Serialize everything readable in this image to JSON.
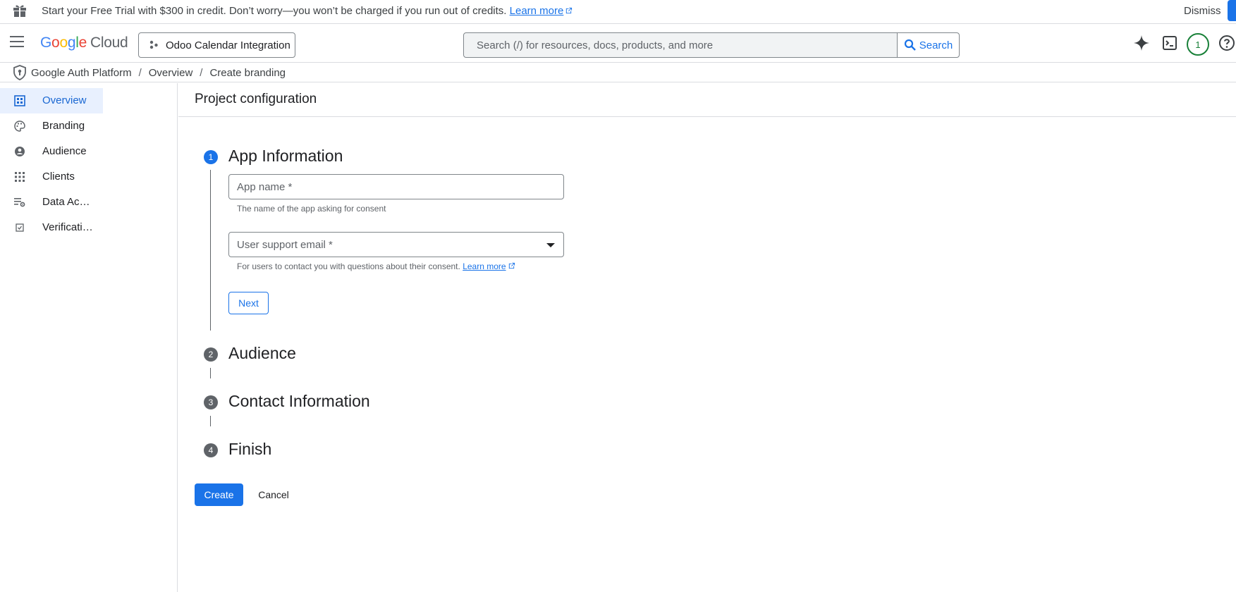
{
  "banner": {
    "message": "Start your Free Trial with $300 in credit. Don’t worry—you won’t be charged if you run out of credits.",
    "learn_more": "Learn more",
    "dismiss": "Dismiss"
  },
  "header": {
    "logo_google": [
      "G",
      "o",
      "o",
      "g",
      "l",
      "e"
    ],
    "logo_cloud": "Cloud",
    "project": "Odoo Calendar Integration",
    "search_placeholder": "Search (/) for resources, docs, products, and more",
    "search_button": "Search",
    "notification_count": "1"
  },
  "breadcrumb": {
    "items": [
      "Google Auth Platform",
      "Overview",
      "Create branding"
    ],
    "separator": "/"
  },
  "sidebar": {
    "items": [
      {
        "label": "Overview",
        "icon": "dashboard-icon",
        "active": true
      },
      {
        "label": "Branding",
        "icon": "palette-icon",
        "active": false
      },
      {
        "label": "Audience",
        "icon": "account-circle-icon",
        "active": false
      },
      {
        "label": "Clients",
        "icon": "apps-grid-icon",
        "active": false
      },
      {
        "label": "Data Access",
        "icon": "list-settings-icon",
        "active": false
      },
      {
        "label": "Verification Center",
        "icon": "check-box-icon",
        "active": false
      }
    ]
  },
  "main": {
    "title": "Project configuration",
    "steps": [
      {
        "number": "1",
        "title": "App Information",
        "active": true
      },
      {
        "number": "2",
        "title": "Audience",
        "active": false
      },
      {
        "number": "3",
        "title": "Contact Information",
        "active": false
      },
      {
        "number": "4",
        "title": "Finish",
        "active": false
      }
    ],
    "app_name": {
      "label": "App name *",
      "hint": "The name of the app asking for consent"
    },
    "support_email": {
      "label": "User support email *",
      "hint": "For users to contact you with questions about their consent.",
      "learn_more": "Learn more"
    },
    "next_label": "Next",
    "create_label": "Create",
    "cancel_label": "Cancel"
  },
  "colors": {
    "accent": "#1a73e8",
    "active_nav_bg": "#e8f0fe",
    "avatar_ring": "#188038"
  }
}
